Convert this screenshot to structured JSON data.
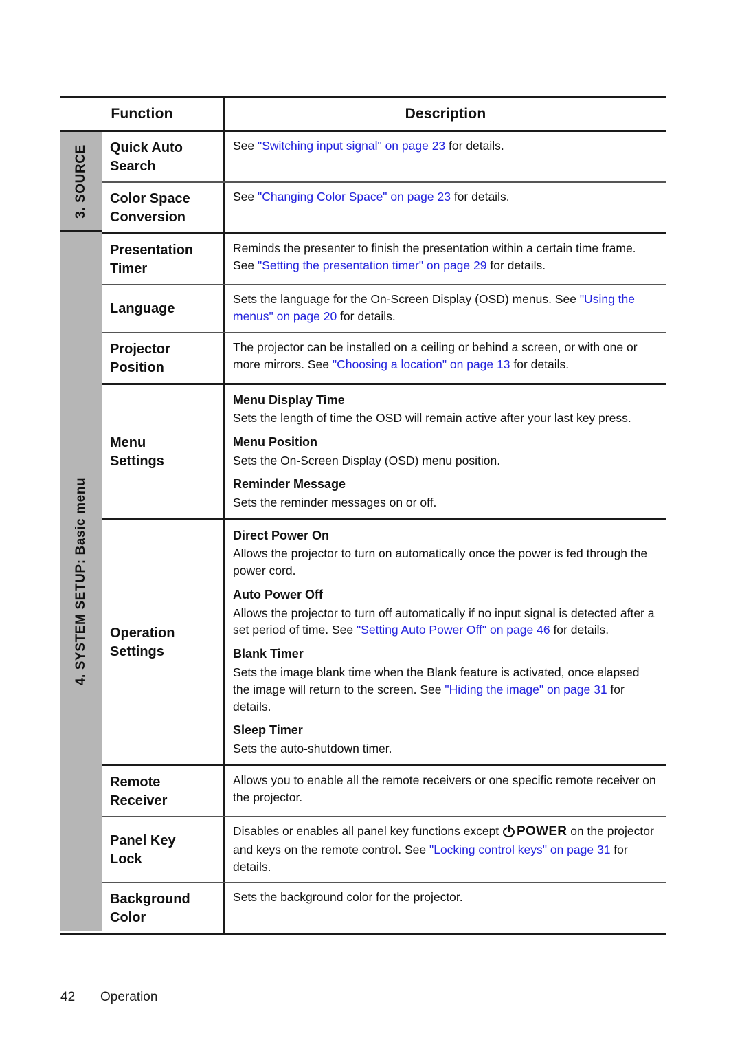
{
  "colors": {
    "link": "#2323dd",
    "sidebar_gray": "#b6b6b6",
    "rule": "#1a1a1a"
  },
  "table": {
    "headers": {
      "function": "Function",
      "description": "Description"
    },
    "sections": [
      {
        "label": "3. SOURCE",
        "rowspan": 2
      },
      {
        "label": "4. SYSTEM SETUP: Basic menu",
        "rowspan": 8
      }
    ],
    "rows": [
      {
        "function": [
          "Quick Auto",
          "Search"
        ],
        "blocks": [
          {
            "type": "para",
            "runs": [
              {
                "t": "See "
              },
              {
                "t": "\"Switching input signal\" on page 23",
                "link": true
              },
              {
                "t": " for details."
              }
            ]
          }
        ]
      },
      {
        "function": [
          "Color Space",
          "Conversion"
        ],
        "blocks": [
          {
            "type": "para",
            "runs": [
              {
                "t": "See "
              },
              {
                "t": "\"Changing Color Space\" on page 23",
                "link": true
              },
              {
                "t": " for details."
              }
            ]
          }
        ]
      },
      {
        "function": [
          "Presentation",
          "Timer"
        ],
        "blocks": [
          {
            "type": "para",
            "runs": [
              {
                "t": "Reminds the presenter to finish the presentation within a certain time frame. See "
              },
              {
                "t": "\"Setting the presentation timer\" on page 29",
                "link": true
              },
              {
                "t": " for details."
              }
            ]
          }
        ]
      },
      {
        "function": [
          "Language"
        ],
        "blocks": [
          {
            "type": "para",
            "runs": [
              {
                "t": "Sets the language for the On-Screen Display (OSD) menus. See "
              },
              {
                "t": "\"Using the menus\" on page 20",
                "link": true
              },
              {
                "t": " for details."
              }
            ]
          }
        ]
      },
      {
        "function": [
          "Projector",
          "Position"
        ],
        "blocks": [
          {
            "type": "para",
            "runs": [
              {
                "t": "The projector can be installed on a ceiling or behind a screen, or with one or more mirrors. See "
              },
              {
                "t": "\"Choosing a location\" on page 13",
                "link": true
              },
              {
                "t": " for details."
              }
            ]
          }
        ]
      },
      {
        "function": [
          "Menu",
          "Settings"
        ],
        "blocks": [
          {
            "type": "sub",
            "runs": [
              {
                "t": "Menu Display Time"
              }
            ]
          },
          {
            "type": "para",
            "runs": [
              {
                "t": "Sets the length of time the OSD will remain active after your last key press."
              }
            ]
          },
          {
            "type": "sub",
            "runs": [
              {
                "t": "Menu Position"
              }
            ]
          },
          {
            "type": "para",
            "runs": [
              {
                "t": "Sets the On-Screen Display (OSD) menu position."
              }
            ]
          },
          {
            "type": "sub",
            "runs": [
              {
                "t": "Reminder Message"
              }
            ]
          },
          {
            "type": "para",
            "runs": [
              {
                "t": "Sets the reminder messages on or off."
              }
            ]
          }
        ]
      },
      {
        "function": [
          "Operation",
          "Settings"
        ],
        "blocks": [
          {
            "type": "sub",
            "runs": [
              {
                "t": "Direct Power On"
              }
            ]
          },
          {
            "type": "para",
            "runs": [
              {
                "t": "Allows the projector to turn on automatically once the power is fed through the power cord."
              }
            ]
          },
          {
            "type": "sub",
            "runs": [
              {
                "t": "Auto Power Off"
              }
            ]
          },
          {
            "type": "para",
            "runs": [
              {
                "t": "Allows the projector to turn off automatically if no input signal is detected after a set period of time. See "
              },
              {
                "t": "\"Setting Auto Power Off\" on page 46",
                "link": true
              },
              {
                "t": " for details."
              }
            ]
          },
          {
            "type": "sub",
            "runs": [
              {
                "t": "Blank Timer"
              }
            ]
          },
          {
            "type": "para",
            "runs": [
              {
                "t": "Sets the image blank time when the Blank feature is activated, once elapsed the image will return to the screen. See "
              },
              {
                "t": "\"Hiding the image\" on page 31",
                "link": true
              },
              {
                "t": " for details."
              }
            ]
          },
          {
            "type": "sub",
            "runs": [
              {
                "t": "Sleep Timer"
              }
            ]
          },
          {
            "type": "para",
            "runs": [
              {
                "t": "Sets the auto-shutdown timer."
              }
            ]
          }
        ]
      },
      {
        "function": [
          "Remote",
          "Receiver"
        ],
        "blocks": [
          {
            "type": "para",
            "runs": [
              {
                "t": "Allows you to enable all the remote receivers or one specific remote receiver on the projector."
              }
            ]
          }
        ]
      },
      {
        "function": [
          "Panel Key",
          "Lock"
        ],
        "blocks": [
          {
            "type": "para",
            "runs": [
              {
                "t": "Disables or enables all panel key functions except "
              },
              {
                "t": "POWER",
                "icon": "power-icon",
                "bold": true
              },
              {
                "t": " on the projector and keys on the remote control. See "
              },
              {
                "t": "\"Locking control keys\" on page 31",
                "link": true
              },
              {
                "t": " for details."
              }
            ]
          }
        ]
      },
      {
        "function": [
          "Background",
          "Color"
        ],
        "blocks": [
          {
            "type": "para",
            "runs": [
              {
                "t": "Sets the background color for the projector."
              }
            ]
          }
        ]
      }
    ]
  },
  "footer": {
    "page_number": "42",
    "chapter": "Operation"
  }
}
